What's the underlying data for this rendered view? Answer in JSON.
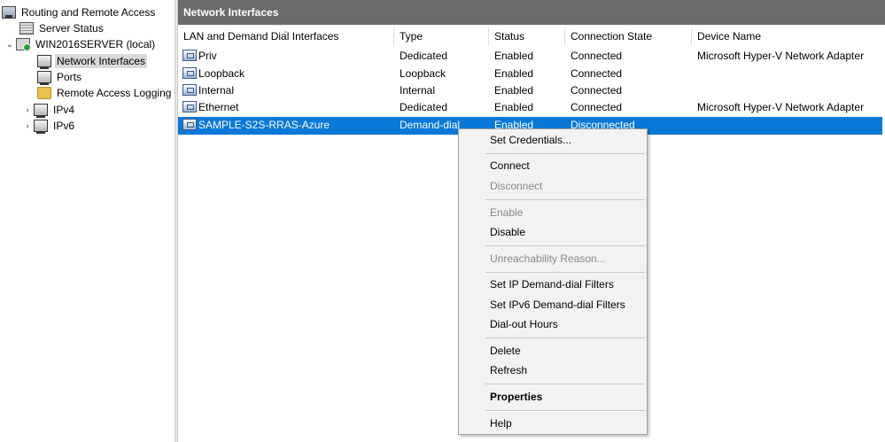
{
  "tree": {
    "root": "Routing and Remote Access",
    "server_status": "Server Status",
    "server": "WIN2016SERVER (local)",
    "network_interfaces": "Network Interfaces",
    "ports": "Ports",
    "remote_access_logging": "Remote Access Logging",
    "ipv4": "IPv4",
    "ipv6": "IPv6"
  },
  "pane": {
    "title": "Network Interfaces",
    "columns": [
      "LAN and Demand Dial Interfaces",
      "Type",
      "Status",
      "Connection State",
      "Device Name"
    ],
    "rows": [
      {
        "name": "Priv",
        "type": "Dedicated",
        "status": "Enabled",
        "state": "Connected",
        "device": "Microsoft Hyper-V Network Adapter"
      },
      {
        "name": "Loopback",
        "type": "Loopback",
        "status": "Enabled",
        "state": "Connected",
        "device": ""
      },
      {
        "name": "Internal",
        "type": "Internal",
        "status": "Enabled",
        "state": "Connected",
        "device": ""
      },
      {
        "name": "Ethernet",
        "type": "Dedicated",
        "status": "Enabled",
        "state": "Connected",
        "device": "Microsoft Hyper-V Network Adapter"
      },
      {
        "name": "SAMPLE-S2S-RRAS-Azure",
        "type": "Demand-dial",
        "status": "Enabled",
        "state": "Disconnected",
        "device": ""
      }
    ]
  },
  "menu": {
    "set_credentials": "Set Credentials...",
    "connect": "Connect",
    "disconnect": "Disconnect",
    "enable": "Enable",
    "disable": "Disable",
    "unreachability_reason": "Unreachability Reason...",
    "set_ip_filters": "Set IP Demand-dial Filters",
    "set_ipv6_filters": "Set IPv6 Demand-dial Filters",
    "dial_out_hours": "Dial-out Hours",
    "delete": "Delete",
    "refresh": "Refresh",
    "properties": "Properties",
    "help": "Help"
  },
  "colors": {
    "title_bar": "#6b6b6b",
    "selection": "#0a78d7",
    "menu_bg": "#f2f2f2"
  }
}
